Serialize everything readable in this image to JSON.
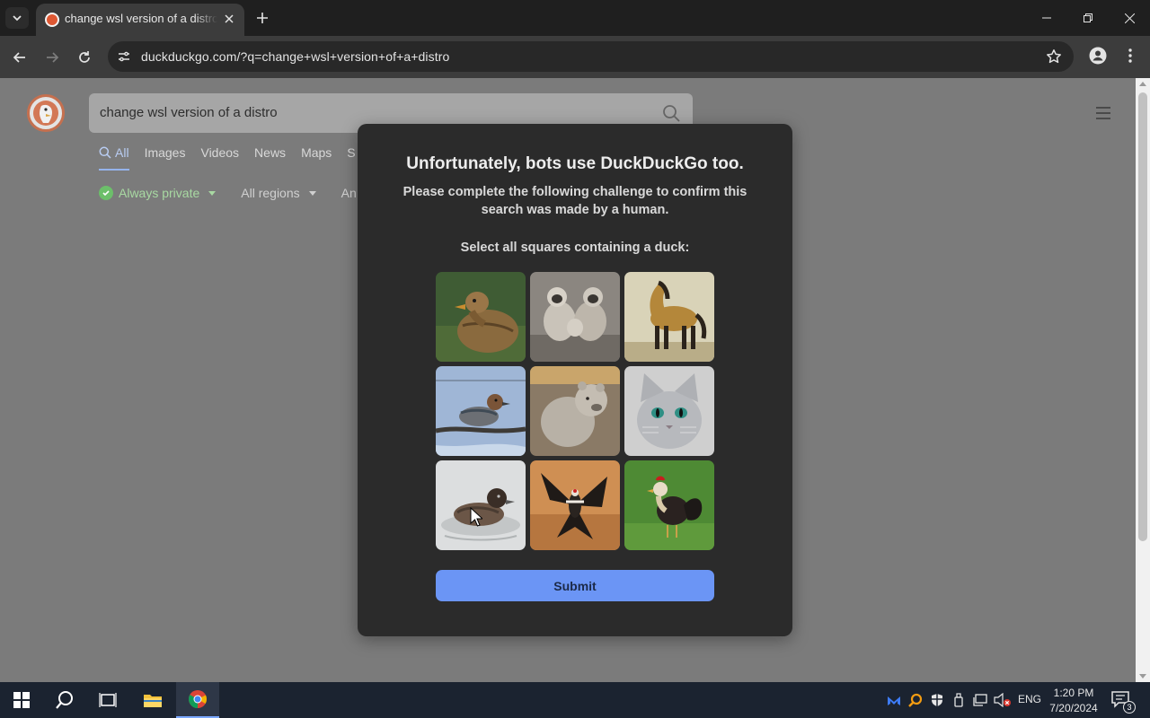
{
  "browser": {
    "tab_title": "change wsl version of a distro at DuckDuckGo",
    "url": "duckduckgo.com/?q=change+wsl+version+of+a+distro"
  },
  "search": {
    "query": "change wsl version of a distro",
    "tabs": [
      "All",
      "Images",
      "Videos",
      "News",
      "Maps",
      "S"
    ],
    "active_tab": "All",
    "filters": {
      "private": "Always private",
      "regions": "All regions",
      "time": "An"
    }
  },
  "challenge": {
    "title": "Unfortunately, bots use DuckDuckGo too.",
    "subtitle": "Please complete the following challenge to confirm this search was made by a human.",
    "prompt": "Select all squares containing a duck:",
    "tiles": [
      "duck",
      "monkeys",
      "horse",
      "duck-on-branch",
      "bear",
      "cat",
      "duck-swimming",
      "bird-flying",
      "rooster"
    ],
    "submit_label": "Submit",
    "submit_color": "#6b95f5"
  },
  "taskbar": {
    "language": "ENG",
    "time": "1:20 PM",
    "date": "7/20/2024",
    "notification_count": "3"
  }
}
